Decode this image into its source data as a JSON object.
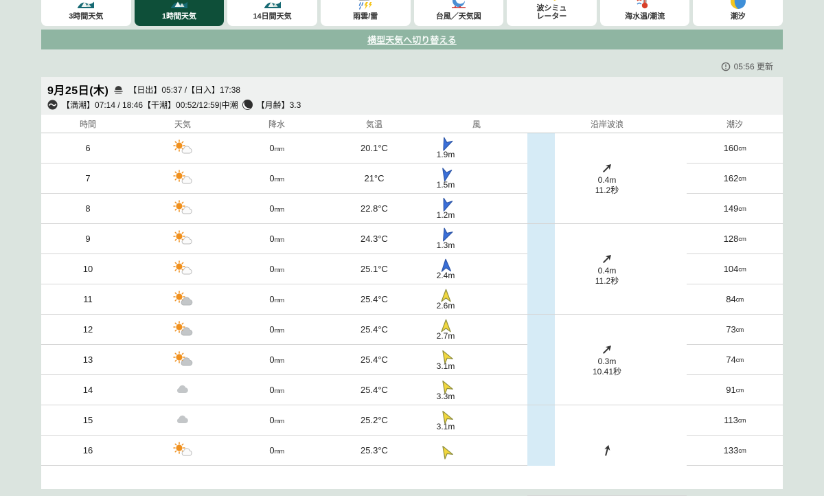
{
  "tabs": [
    {
      "label": "3時間天気",
      "icon": "logo-icon",
      "selected": false
    },
    {
      "label": "1時間天気",
      "icon": "logo-icon",
      "selected": true
    },
    {
      "label": "14日間天気",
      "icon": "logo-icon",
      "selected": false
    },
    {
      "label": "雨雲/雷",
      "icon": "rain-radar-icon",
      "selected": false
    },
    {
      "label": "台風／天気図",
      "icon": "typhoon-icon",
      "selected": false
    },
    {
      "label": "波シミュ\nレーター",
      "icon": "wave-sim-icon",
      "selected": false
    },
    {
      "label": "海水温/潮流",
      "icon": "sea-temp-icon",
      "selected": false
    },
    {
      "label": "潮汐",
      "icon": "tide-icon",
      "selected": false
    }
  ],
  "banner": {
    "link_label": "横型天気へ切り替える"
  },
  "updated": {
    "text": "05:56 更新",
    "icon": "clock-icon"
  },
  "date_header": {
    "date": "9月25日(木)",
    "sun_times": "【日出】05:37 /【日入】17:38",
    "tide_times": "【満潮】07:14 / 18:46【干潮】00:52/12:59|中潮",
    "moon_age": "【月齢】3.3",
    "icons": [
      "sunrise-icon",
      "wave-icon",
      "moon-icon"
    ]
  },
  "table": {
    "headers": [
      "時間",
      "天気",
      "降水",
      "気温",
      "風",
      "沿岸波浪",
      "潮汐"
    ],
    "units": {
      "rain": "mm",
      "tide": "cm"
    },
    "rows": [
      {
        "hour": "6",
        "weather": "sun-cloud",
        "rain": "0",
        "temp": "20.1°C",
        "wind": {
          "deg": 203,
          "color": "blue",
          "speed": "1.9m"
        },
        "tide": "160"
      },
      {
        "hour": "7",
        "weather": "sun-cloud",
        "rain": "0",
        "temp": "21°C",
        "wind": {
          "deg": 192,
          "color": "blue",
          "speed": "1.5m"
        },
        "tide": "162"
      },
      {
        "hour": "8",
        "weather": "sun-cloud",
        "rain": "0",
        "temp": "22.8°C",
        "wind": {
          "deg": 200,
          "color": "blue",
          "speed": "1.2m"
        },
        "tide": "149"
      },
      {
        "hour": "9",
        "weather": "sun-cloud",
        "rain": "0",
        "temp": "24.3°C",
        "wind": {
          "deg": 205,
          "color": "blue",
          "speed": "1.3m"
        },
        "tide": "128"
      },
      {
        "hour": "10",
        "weather": "sun-cloud",
        "rain": "0",
        "temp": "25.1°C",
        "wind": {
          "deg": 357,
          "color": "blue",
          "speed": "2.4m"
        },
        "tide": "104"
      },
      {
        "hour": "11",
        "weather": "sun-graycloud",
        "rain": "0",
        "temp": "25.4°C",
        "wind": {
          "deg": 0,
          "color": "yellow",
          "speed": "2.6m"
        },
        "tide": "84"
      },
      {
        "hour": "12",
        "weather": "sun-graycloud",
        "rain": "0",
        "temp": "25.4°C",
        "wind": {
          "deg": 0,
          "color": "yellow",
          "speed": "2.7m"
        },
        "tide": "73"
      },
      {
        "hour": "13",
        "weather": "sun-graycloud",
        "rain": "0",
        "temp": "25.4°C",
        "wind": {
          "deg": -30,
          "color": "yellow",
          "speed": "3.1m"
        },
        "tide": "74"
      },
      {
        "hour": "14",
        "weather": "cloud",
        "rain": "0",
        "temp": "25.4°C",
        "wind": {
          "deg": -30,
          "color": "yellow",
          "speed": "3.3m"
        },
        "tide": "91"
      },
      {
        "hour": "15",
        "weather": "cloud",
        "rain": "0",
        "temp": "25.2°C",
        "wind": {
          "deg": -30,
          "color": "yellow",
          "speed": "3.1m"
        },
        "tide": "113"
      },
      {
        "hour": "16",
        "weather": "sun-cloud",
        "rain": "0",
        "temp": "25.3°C",
        "wind": {
          "deg": -30,
          "color": "yellow",
          "speed": ""
        },
        "tide": "133"
      }
    ],
    "wave_groups": [
      {
        "arrow_deg": 45,
        "height": "0.4m",
        "period": "11.2秒"
      },
      {
        "arrow_deg": 45,
        "height": "0.4m",
        "period": "11.2秒"
      },
      {
        "arrow_deg": 45,
        "height": "0.3m",
        "period": "10.41秒"
      },
      {
        "arrow_deg": 15,
        "height": "",
        "period": ""
      }
    ]
  },
  "colors": {
    "page_bg": "#dbe4df",
    "banner_green": "#8fb5a2",
    "selected_tab_green": "#0e4f39",
    "wave_strip_blue": "#d6ebf6",
    "wind_blue": "#3a6fd8",
    "wind_yellow": "#f2d73e",
    "sun_orange": "#f0901d"
  }
}
